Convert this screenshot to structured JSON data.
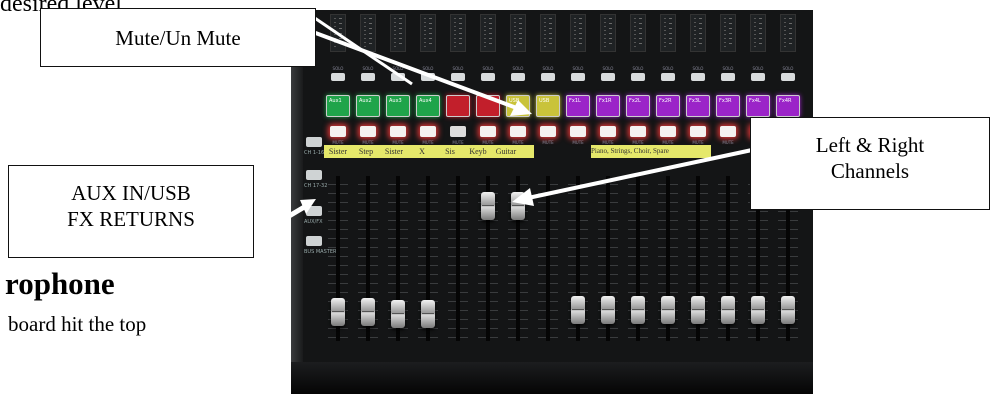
{
  "doc_fragments": {
    "top": "desired level",
    "heading": "rophone",
    "body": "board hit the top"
  },
  "callouts": {
    "mute": "Mute/Un Mute",
    "aux_line1": "AUX IN/USB",
    "aux_line2": "FX RETURNS",
    "lr_line1": "Left & Right",
    "lr_line2": "Channels"
  },
  "mixer": {
    "section_buttons": [
      "CH 1-16",
      "CH 17-32",
      "AUX/FX",
      "BUS MASTER"
    ],
    "solo_label": "SOLO",
    "mute_label": "MUTE",
    "scribble_strips": [
      "Aux1",
      "Aux2",
      "Aux3",
      "Aux4",
      "",
      "",
      "USB",
      "USB",
      "Fx1L",
      "Fx1R",
      "Fx2L",
      "Fx2R",
      "Fx3L",
      "Fx3R",
      "Fx4L",
      "Fx4R"
    ],
    "tape_left": [
      "Sister",
      "Step",
      "Sister",
      "X",
      "Sis",
      "Keyb",
      "Guitar"
    ],
    "tape_right": "Piano, Strings, Choir, Spare"
  },
  "colors": {
    "green": "#1fa44a",
    "red": "#c21f2b",
    "yellow": "#c9c33a",
    "purple": "#9b24c8",
    "tape": "#e5e86a"
  }
}
